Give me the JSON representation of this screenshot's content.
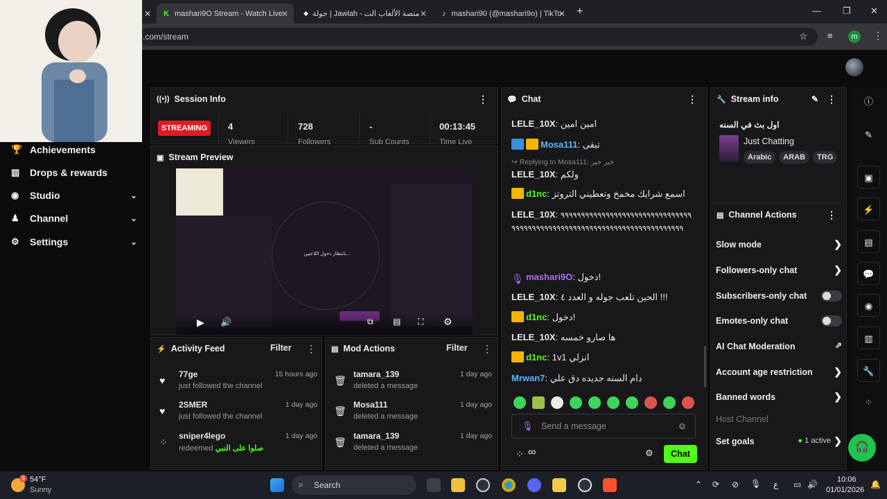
{
  "browser": {
    "tabs": [
      {
        "title": "mashari9O Stream - Watch Live"
      },
      {
        "title": "جولة | Jawlah - منصة الألعاب الت"
      },
      {
        "title": "mashari90 (@mashari9o) | TikTo"
      }
    ],
    "url": ".com/stream",
    "profile_initial": "m",
    "new_tab": "+"
  },
  "sidebar": {
    "items": [
      {
        "label": "Achievements",
        "icon": "trophy-icon"
      },
      {
        "label": "Drops & rewards",
        "icon": "gift-icon"
      },
      {
        "label": "Studio",
        "icon": "studio-icon"
      },
      {
        "label": "Channel",
        "icon": "channel-icon"
      },
      {
        "label": "Settings",
        "icon": "gear-icon"
      }
    ]
  },
  "session": {
    "title": "Session Info",
    "status": "STREAMING",
    "stats": [
      {
        "value": "4",
        "label": "Viewers"
      },
      {
        "value": "728",
        "label": "Followers"
      },
      {
        "value": "-",
        "label": "Sub Counts"
      },
      {
        "value": "00:13:45",
        "label": "Time Live"
      }
    ]
  },
  "preview": {
    "title": "Stream Preview",
    "waiting_text": "بانتظار دخول اللاعبين..."
  },
  "activity": {
    "title": "Activity Feed",
    "filter": "Filter",
    "items": [
      {
        "user": "77ge",
        "action": "just followed the channel",
        "time": "15 hours ago",
        "icon": "heart-icon"
      },
      {
        "user": "2SMER",
        "action": "just followed the channel",
        "time": "1 day ago",
        "icon": "heart-icon"
      },
      {
        "user": "sniper4lego",
        "action": "redeemed",
        "reward": "صلوا على النبي",
        "time": "1 day ago",
        "icon": "points-icon"
      }
    ]
  },
  "mod": {
    "title": "Mod Actions",
    "filter": "Filter",
    "items": [
      {
        "user": "tamara_139",
        "action": "deleted a message",
        "time": "1 day ago"
      },
      {
        "user": "Mosa111",
        "action": "deleted a message",
        "time": "1 day ago"
      },
      {
        "user": "tamara_139",
        "action": "deleted a message",
        "time": "1 day ago"
      }
    ]
  },
  "chat": {
    "title": "Chat",
    "messages": [
      {
        "user": "LELE_10X",
        "text": "امين امين",
        "color": "#e8e8ea",
        "badge": ""
      },
      {
        "user": "Mosa111",
        "text": "تبقى",
        "color": "#5fb3ff",
        "badge": "blue+crown"
      },
      {
        "reply": "Replying to Mosa111: خير خير"
      },
      {
        "user": "LELE_10X",
        "text": "ولكم",
        "color": "#e8e8ea",
        "badge": ""
      },
      {
        "user": "d1nc",
        "text": "اسمع شرايك مخمخ وتعطيني التروتز",
        "color": "#53fc18",
        "badge": "crown"
      },
      {
        "user": "LELE_10X",
        "text": "٩٩٩٩٩٩٩٩٩٩٩٩٩٩٩٩٩٩٩٩٩٩٩٩٩٩٩٩٩٩٩٩٩٩٩٩٩٩٩٩٩٩٩٩٩٩٩٩٩٩٩٩٩٩٩٩٩٩٩٩٩٩٩٩٩٩٩٩٩٩٩٩٩٩",
        "color": "#e8e8ea",
        "badge": ""
      },
      {
        "user": "mashari9O",
        "text": "دخول!",
        "color": "#b36cf5",
        "badge": "mic"
      },
      {
        "user": "LELE_10X",
        "text": "الحين تلعب جوله و العدد ٤ !!!",
        "color": "#e8e8ea",
        "badge": ""
      },
      {
        "user": "d1nc",
        "text": "دخول!",
        "color": "#53fc18",
        "badge": "crown"
      },
      {
        "user": "LELE_10X",
        "text": "ها صارو خمسه",
        "color": "#e8e8ea",
        "badge": ""
      },
      {
        "user": "d1nc",
        "text": "1v1 انزلي",
        "color": "#53fc18",
        "badge": "crown"
      },
      {
        "user": "Mrwan7",
        "text": "دام السنه جديده دق علي",
        "color": "#5fb3ff",
        "badge": ""
      }
    ],
    "placeholder": "Send a message",
    "send_label": "Chat",
    "infinity": "∞"
  },
  "stream_info": {
    "title": "Stream info",
    "stream_title": "اول بث في السنه",
    "category": "Just Chatting",
    "tags": [
      "Arabic",
      "ARAB",
      "TRG"
    ]
  },
  "channel_actions": {
    "title": "Channel Actions",
    "rows": [
      {
        "label": "Slow mode",
        "control": "chevron"
      },
      {
        "label": "Followers-only chat",
        "control": "chevron"
      },
      {
        "label": "Subscribers-only chat",
        "control": "toggle"
      },
      {
        "label": "Emotes-only chat",
        "control": "toggle"
      },
      {
        "label": "AI Chat Moderation",
        "control": "external"
      },
      {
        "label": "Account age restriction",
        "control": "chevron"
      },
      {
        "label": "Banned words",
        "control": "chevron"
      }
    ],
    "host_channel": "Host Channel",
    "set_goals": "Set goals",
    "goals_active": "1 active"
  },
  "taskbar": {
    "weather_temp": "54°F",
    "weather_desc": "Sunny",
    "weather_badge": "3",
    "search": "Search",
    "time": "10:06",
    "date": "01/01/2026",
    "lang": "ع"
  },
  "colors": {
    "accent": "#53fc18",
    "live_red": "#e01b24",
    "panel_bg": "#18181b",
    "page_bg": "#0b0b0d"
  }
}
